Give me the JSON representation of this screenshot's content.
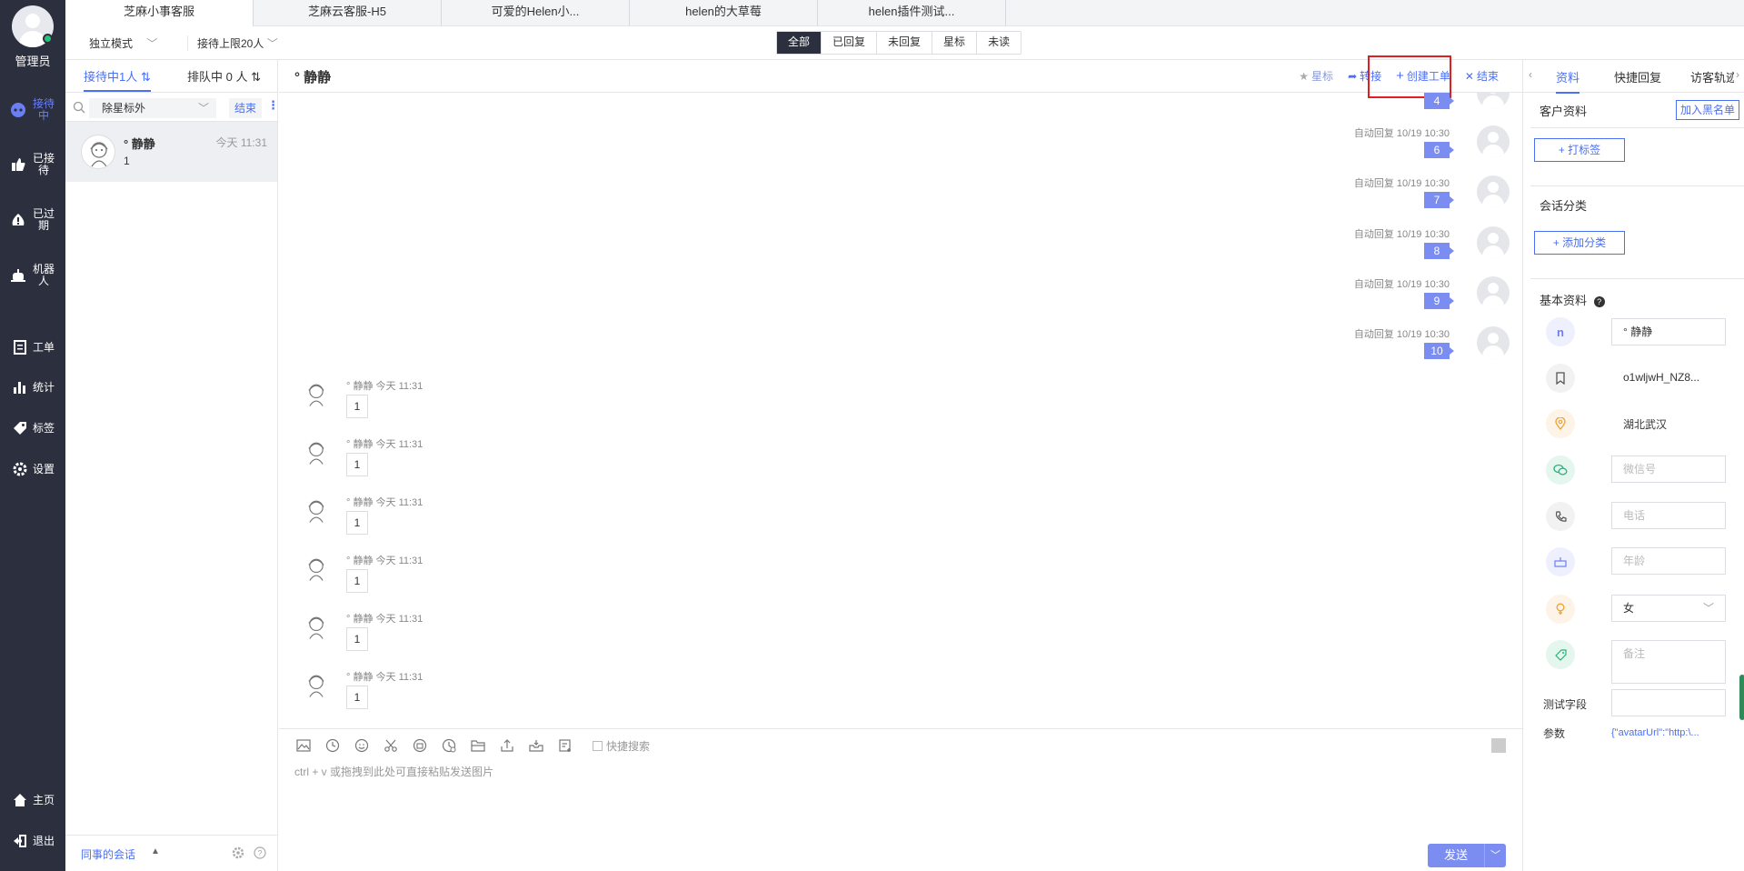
{
  "nav": {
    "admin_label": "管理员",
    "items": [
      {
        "label": "接待中",
        "icon": "chat-bot-icon"
      },
      {
        "label": "已接待",
        "icon": "hand-icon"
      },
      {
        "label": "已过期",
        "icon": "expired-icon"
      },
      {
        "label": "机器人",
        "icon": "robot-icon"
      },
      {
        "label": "工单",
        "icon": "ticket-icon"
      },
      {
        "label": "统计",
        "icon": "bar-chart-icon"
      },
      {
        "label": "标签",
        "icon": "tag-icon"
      },
      {
        "label": "设置",
        "icon": "gear-icon"
      },
      {
        "label": "主页",
        "icon": "home-icon"
      },
      {
        "label": "退出",
        "icon": "logout-icon"
      }
    ]
  },
  "top_tabs": [
    "芝麻小事客服",
    "芝麻云客服-H5",
    "可爱的Helen小...",
    "helen的大草莓",
    "helen插件测试..."
  ],
  "filter": {
    "mode": "独立模式",
    "limit": "接待上限20人",
    "tabs": [
      "全部",
      "已回复",
      "未回复",
      "星标",
      "未读"
    ]
  },
  "sessions": {
    "tab_active": "接待中1人",
    "tab_queue": "排队中 0 人",
    "filter_select": "除星标外",
    "end_label": "结束",
    "items": [
      {
        "name": "° 静静",
        "time": "今天 11:31",
        "last": "1"
      }
    ],
    "footer_label": "同事的会话"
  },
  "chat": {
    "title": "° 静静",
    "actions": {
      "star": "星标",
      "transfer": "转接",
      "create_ticket": "创建工单",
      "end": "结束"
    },
    "auto_msgs": [
      {
        "meta": "",
        "text": "4"
      },
      {
        "meta": "自动回复  10/19 10:30",
        "text": "6"
      },
      {
        "meta": "自动回复  10/19 10:30",
        "text": "7"
      },
      {
        "meta": "自动回复  10/19 10:30",
        "text": "8"
      },
      {
        "meta": "自动回复  10/19 10:30",
        "text": "9"
      },
      {
        "meta": "自动回复  10/19 10:30",
        "text": "10"
      }
    ],
    "cust_msgs": [
      {
        "meta": "° 静静  今天 11:31",
        "text": "1"
      },
      {
        "meta": "° 静静  今天 11:31",
        "text": "1"
      },
      {
        "meta": "° 静静  今天 11:31",
        "text": "1"
      },
      {
        "meta": "° 静静  今天 11:31",
        "text": "1"
      },
      {
        "meta": "° 静静  今天 11:31",
        "text": "1"
      },
      {
        "meta": "° 静静  今天 11:31",
        "text": "1"
      }
    ],
    "quick_search": "快捷搜索",
    "input_hint": "ctrl + v 或拖拽到此处可直接粘贴发送图片",
    "send_label": "发送"
  },
  "right_panel": {
    "tabs": [
      "资料",
      "快捷回复",
      "访客轨迹"
    ],
    "customer_info": "客户资料",
    "blacklist": "加入黑名单",
    "tag_btn": "+ 打标签",
    "category_label": "会话分类",
    "category_btn": "+ 添加分类",
    "basic_info": "基本资料",
    "nickname": "°  静静",
    "openid": "o1wljwH_NZ8...",
    "location": "湖北武汉",
    "wechat_placeholder": "微信号",
    "phone_placeholder": "电话",
    "age_placeholder": "年龄",
    "gender": "女",
    "remark_placeholder": "备注",
    "test_field_label": "测试字段",
    "params_label": "参数",
    "params_value": "{\"avatarUrl\":\"http:\\..."
  },
  "colors": {
    "nav_bg": "#2b2f3e",
    "accent": "#4b6ff5",
    "bubble": "#7b8df0",
    "highlight_box": "#e02020"
  }
}
